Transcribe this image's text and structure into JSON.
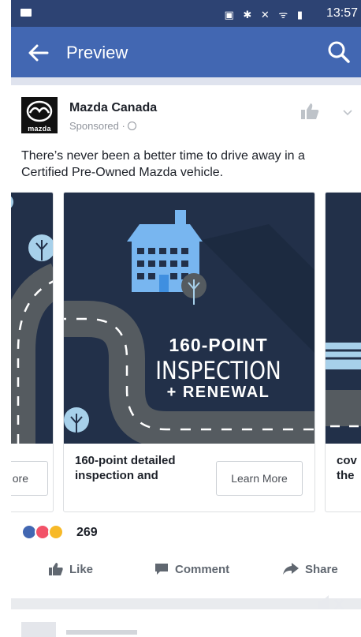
{
  "status_bar": {
    "time": "13:57"
  },
  "app_bar": {
    "title": "Preview"
  },
  "post": {
    "author": "Mazda Canada",
    "logo_text": "mazda",
    "sponsored": "Sponsored ·",
    "message": "There’s never been a better time to drive away in a Certified Pre-Owned Mazda vehicle."
  },
  "carousel": {
    "left_card": {
      "cta_label": "ore"
    },
    "main_card": {
      "headline_line1": "160-POINT",
      "headline_line2": "INSPECTION",
      "headline_line3": "+ RENEWAL",
      "description": "160-point detailed inspection and",
      "cta_label": "Learn More"
    },
    "right_card": {
      "description": "cov the"
    }
  },
  "reactions": {
    "count": "269"
  },
  "actions": {
    "like": "Like",
    "comment": "Comment",
    "share": "Share"
  },
  "colors": {
    "facebook_blue": "#4267b2",
    "status_bar": "#2d4373",
    "ad_background": "#223049",
    "building_blue": "#78b6f0",
    "road_grey": "#555b60",
    "tree_blue": "#a7d0ea"
  }
}
